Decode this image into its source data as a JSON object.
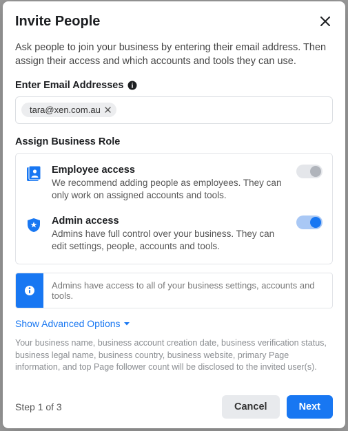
{
  "modal": {
    "title": "Invite People",
    "intro": "Ask people to join your business by entering their email address. Then assign their access and which accounts and tools they can use.",
    "email_label": "Enter Email Addresses",
    "email_chip": "tara@xen.com.au",
    "role_section_label": "Assign Business Role",
    "roles": {
      "employee": {
        "title": "Employee access",
        "desc": "We recommend adding people as employees. They can only work on assigned accounts and tools."
      },
      "admin": {
        "title": "Admin access",
        "desc": "Admins have full control over your business. They can edit settings, people, accounts and tools."
      }
    },
    "info_text": "Admins have access to all of your business settings, accounts and tools.",
    "advanced_toggle": "Show Advanced Options",
    "disclosure": "Your business name, business account creation date, business verification status, business legal name, business country, business website, primary Page information, and top Page follower count will be disclosed to the invited user(s).",
    "step_indicator": "Step 1 of 3",
    "cancel_label": "Cancel",
    "next_label": "Next"
  }
}
